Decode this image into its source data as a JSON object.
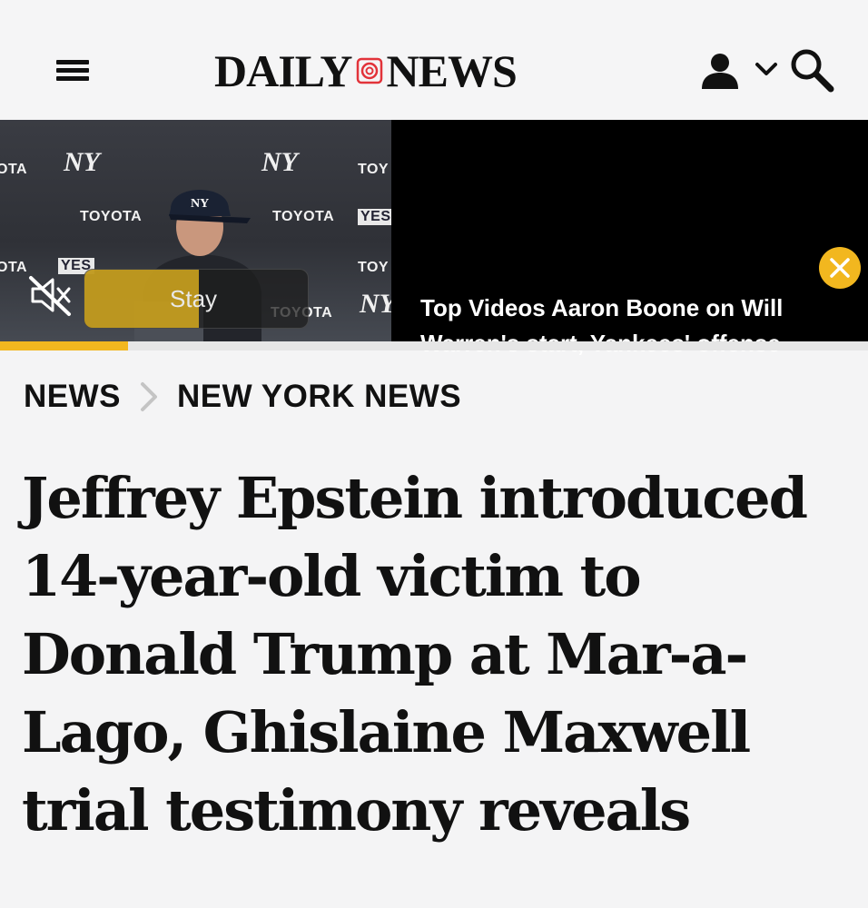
{
  "header": {
    "logo_left": "DAILY",
    "logo_right": "NEWS"
  },
  "video": {
    "title": "Top Videos Aaron Boone on Will Warren's start, Yankees' offense",
    "stay_label": "Stay",
    "progress_percent": 14.7,
    "backdrop": {
      "sponsor": "TOYOTA",
      "network": "YES",
      "sponsor_partial_1": "OTA",
      "sponsor_partial_2": "TOY",
      "team_mark": "NY"
    }
  },
  "breadcrumb": {
    "items": [
      "NEWS",
      "NEW YORK NEWS"
    ]
  },
  "article": {
    "headline": "Jeffrey Epstein introduced 14-year-old victim to Donald Trump at Mar-a-Lago, Ghislaine Maxwell trial testimony reveals"
  },
  "colors": {
    "accent": "#f2b71f",
    "logo_mark": "#e2333a",
    "text": "#111111"
  },
  "icons": [
    "menu-icon",
    "logo-mark-icon",
    "account-icon",
    "chevron-down-icon",
    "search-icon",
    "mute-icon",
    "close-icon",
    "chevron-right-icon"
  ]
}
